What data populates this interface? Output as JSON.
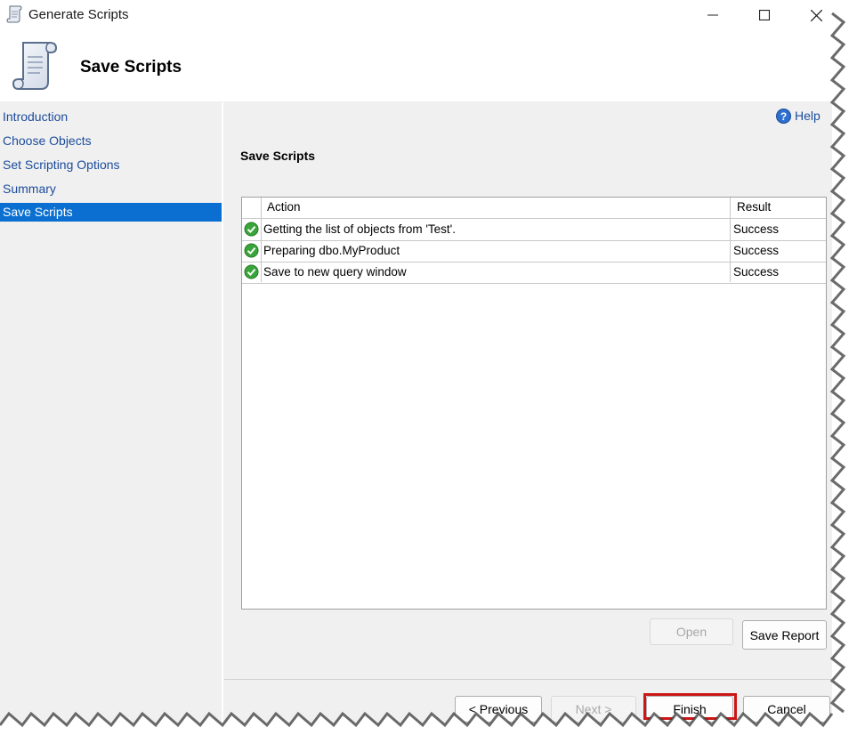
{
  "window": {
    "title": "Generate Scripts",
    "controls": [
      "minimize-icon",
      "maximize-icon",
      "close-icon"
    ]
  },
  "header": {
    "title": "Save Scripts",
    "icon": "script-scroll-icon"
  },
  "sidebar": {
    "items": [
      {
        "label": "Introduction",
        "active": false
      },
      {
        "label": "Choose Objects",
        "active": false
      },
      {
        "label": "Set Scripting Options",
        "active": false
      },
      {
        "label": "Summary",
        "active": false
      },
      {
        "label": "Save Scripts",
        "active": true
      }
    ]
  },
  "main": {
    "help_label": "Help",
    "section_title": "Save Scripts",
    "grid": {
      "columns": [
        "Action",
        "Result"
      ],
      "rows": [
        {
          "status_icon": "success-check-icon",
          "action": "Getting the list of objects from 'Test'.",
          "result": "Success"
        },
        {
          "status_icon": "success-check-icon",
          "action": "Preparing dbo.MyProduct",
          "result": "Success"
        },
        {
          "status_icon": "success-check-icon",
          "action": "Save to new query window",
          "result": "Success"
        }
      ]
    },
    "open_label": "Open",
    "save_report_label": "Save Report"
  },
  "footer": {
    "previous_label": "< Previous",
    "next_label": "Next >",
    "finish_label": "Finish",
    "cancel_label": "Cancel"
  },
  "colors": {
    "accent": "#0a6fd0",
    "link": "#1c4c9c",
    "highlight": "#cc1616",
    "success": "#3aa53a"
  }
}
